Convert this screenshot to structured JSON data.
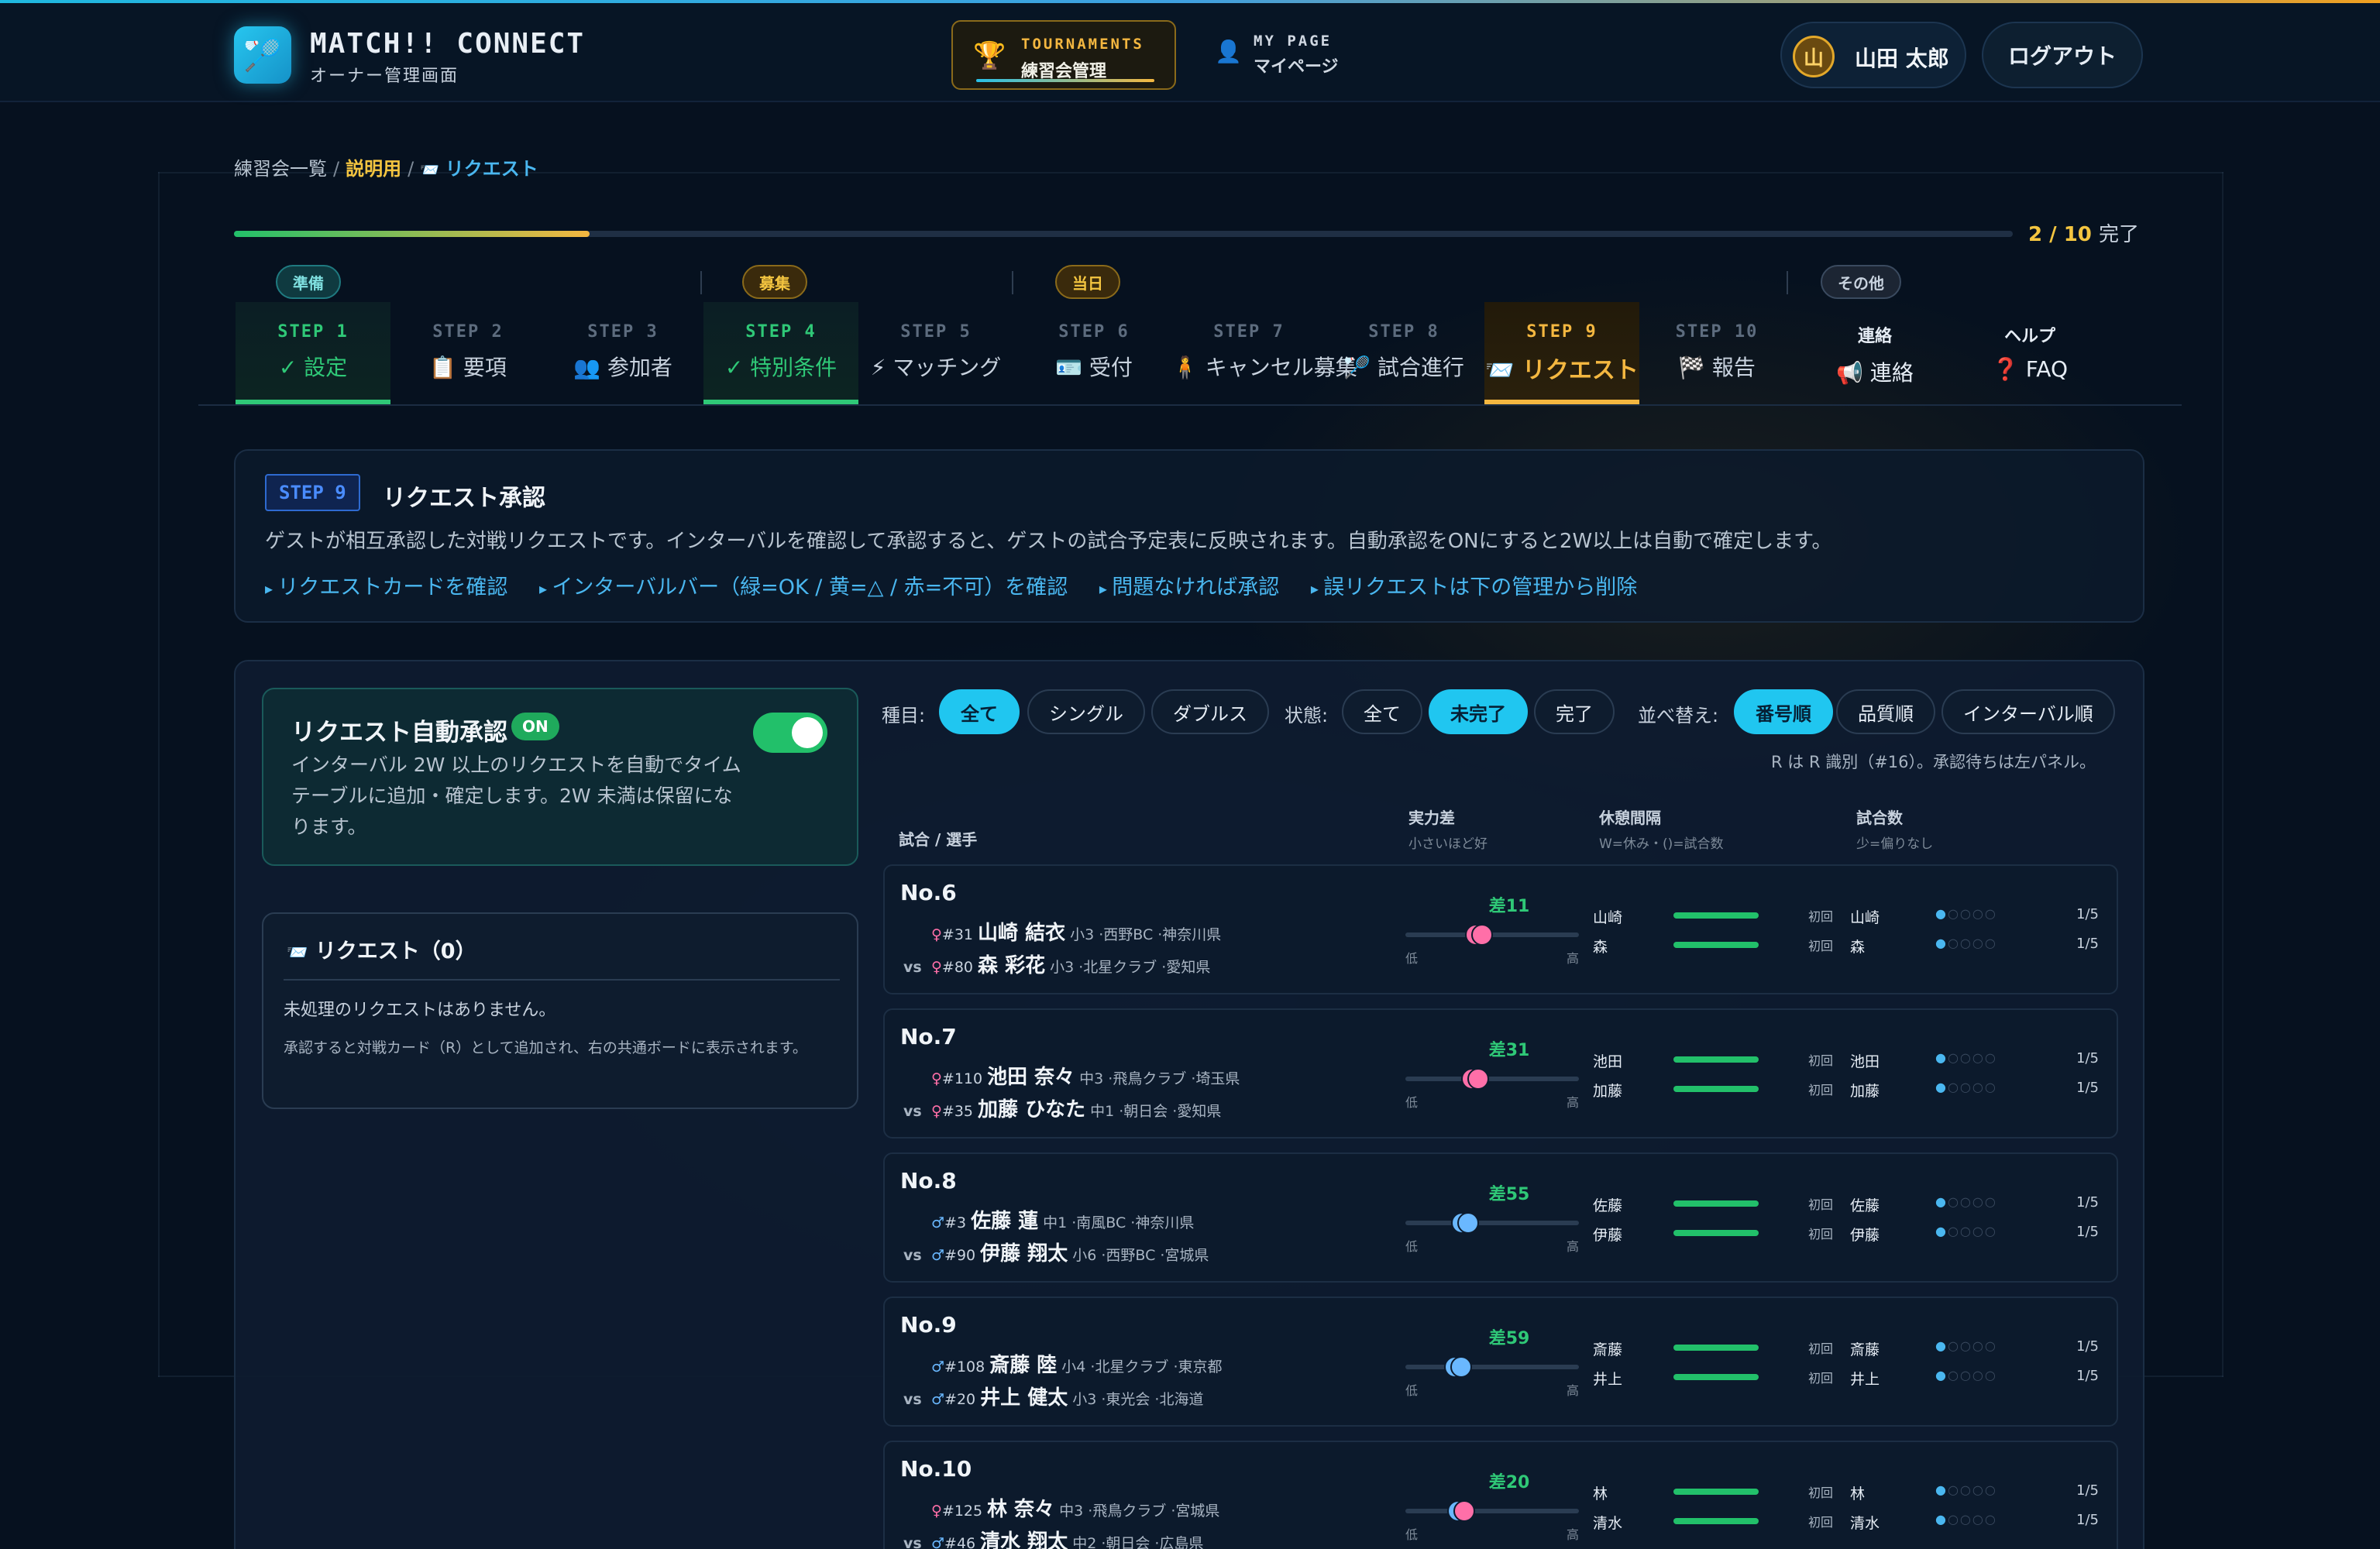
{
  "header": {
    "brand": "MATCH!! CONNECT",
    "brand_sub": "オーナー管理画面",
    "nav_tournaments_en": "TOURNAMENTS",
    "nav_tournaments_jp": "練習会管理",
    "nav_mypage_en": "MY PAGE",
    "nav_mypage_jp": "マイページ",
    "user_initial": "山",
    "user_name": "山田 太郎",
    "logout": "ログアウト"
  },
  "breadcrumb": {
    "root": "練習会一覧",
    "current": "説明用",
    "page": "リクエスト"
  },
  "progress": {
    "done": 2,
    "total": 10,
    "label_count": "2 / 10",
    "label_suffix": "完了",
    "fraction": 0.2
  },
  "groups": {
    "prep": "準備",
    "boshu": "募集",
    "day": "当日",
    "other": "その他"
  },
  "steps": [
    {
      "num": "STEP 1",
      "label": "✓ 設定"
    },
    {
      "num": "STEP 2",
      "label": "📋 要項"
    },
    {
      "num": "STEP 3",
      "label": "👥 参加者"
    },
    {
      "num": "STEP 4",
      "label": "✓ 特別条件"
    },
    {
      "num": "STEP 5",
      "label": "⚡ マッチング"
    },
    {
      "num": "STEP 6",
      "label": "🪪 受付"
    },
    {
      "num": "STEP 7",
      "label": "🧍 キャンセル募集"
    },
    {
      "num": "STEP 8",
      "label": "🏸 試合進行"
    },
    {
      "num": "STEP 9",
      "label": "📨 リクエスト"
    },
    {
      "num": "STEP 10",
      "label": "🏁 報告"
    },
    {
      "num": "連絡",
      "label": "📢 連絡"
    },
    {
      "num": "ヘルプ",
      "label": "❓ FAQ"
    }
  ],
  "info": {
    "badge": "STEP 9",
    "title": "リクエスト承認",
    "desc": "ゲストが相互承認した対戦リクエストです。インターバルを確認して承認すると、ゲストの試合予定表に反映されます。自動承認をONにすると2W以上は自動で確定します。",
    "tips": [
      "リクエストカードを確認",
      "インターバルバー（緑=OK / 黄=△ / 赤=不可）を確認",
      "問題なければ承認",
      "誤リクエストは下の管理から削除"
    ]
  },
  "auto": {
    "title": "リクエスト自動承認",
    "on": "ON",
    "desc": "インターバル 2W 以上のリクエストを自動でタイムテーブルに追加・確定します。2W 未満は保留になります。"
  },
  "requests": {
    "title": "リクエスト（0）",
    "empty": "未処理のリクエストはありません。",
    "note": "承認すると対戦カード（R）として追加され、右の共通ボードに表示されます。"
  },
  "filters": {
    "type_label": "種目:",
    "type_all": "全て",
    "type_single": "シングル",
    "type_double": "ダブルス",
    "state_label": "状態:",
    "state_all": "全て",
    "state_incomplete": "未完了",
    "state_done": "完了",
    "sort_label": "並べ替え:",
    "sort_number": "番号順",
    "sort_quality": "品質順",
    "sort_interval": "インターバル順",
    "note": "R は R 識別（#16）。承認待ちは左パネル。"
  },
  "table": {
    "col_match": "試合 / 選手",
    "col_diff": "実力差",
    "col_diff_sub": "小さいほど好",
    "col_rest": "休憩間隔",
    "col_rest_sub": "W=休み・()=試合数",
    "col_count": "試合数",
    "col_count_sub": "少=偏りなし",
    "low": "低",
    "high": "高",
    "first": "初回",
    "count": "1/5"
  },
  "matches": [
    {
      "no": "No.6",
      "diff": "差11",
      "pos": 0.36,
      "p1": {
        "sx": "♀",
        "id": "#31",
        "name": "山崎 結衣",
        "meta": "小3 ·西野BC ·神奈川県",
        "short": "山崎"
      },
      "p2": {
        "sx": "♀",
        "id": "#80",
        "name": "森 彩花",
        "meta": "小3 ·北星クラブ ·愛知県",
        "short": "森"
      }
    },
    {
      "no": "No.7",
      "diff": "差31",
      "pos": 0.34,
      "p1": {
        "sx": "♀",
        "id": "#110",
        "name": "池田 奈々",
        "meta": "中3 ·飛鳥クラブ ·埼玉県",
        "short": "池田"
      },
      "p2": {
        "sx": "♀",
        "id": "#35",
        "name": "加藤 ひなた",
        "meta": "中1 ·朝日会 ·愛知県",
        "short": "加藤"
      }
    },
    {
      "no": "No.8",
      "diff": "差55",
      "pos": 0.28,
      "p1": {
        "sx": "♂",
        "id": "#3",
        "name": "佐藤 蓮",
        "meta": "中1 ·南風BC ·神奈川県",
        "short": "佐藤"
      },
      "p2": {
        "sx": "♂",
        "id": "#90",
        "name": "伊藤 翔太",
        "meta": "小6 ·西野BC ·宮城県",
        "short": "伊藤"
      }
    },
    {
      "no": "No.9",
      "diff": "差59",
      "pos": 0.24,
      "p1": {
        "sx": "♂",
        "id": "#108",
        "name": "斎藤 陸",
        "meta": "小4 ·北星クラブ ·東京都",
        "short": "斎藤"
      },
      "p2": {
        "sx": "♂",
        "id": "#20",
        "name": "井上 健太",
        "meta": "小3 ·東光会 ·北海道",
        "short": "井上"
      }
    },
    {
      "no": "No.10",
      "diff": "差20",
      "pos": 0.26,
      "p1": {
        "sx": "♀",
        "id": "#125",
        "name": "林 奈々",
        "meta": "中3 ·飛鳥クラブ ·宮城県",
        "short": "林"
      },
      "p2": {
        "sx": "♂",
        "id": "#46",
        "name": "清水 翔太",
        "meta": "中2 ·朝日会 ·広島県",
        "short": "清水"
      }
    }
  ]
}
